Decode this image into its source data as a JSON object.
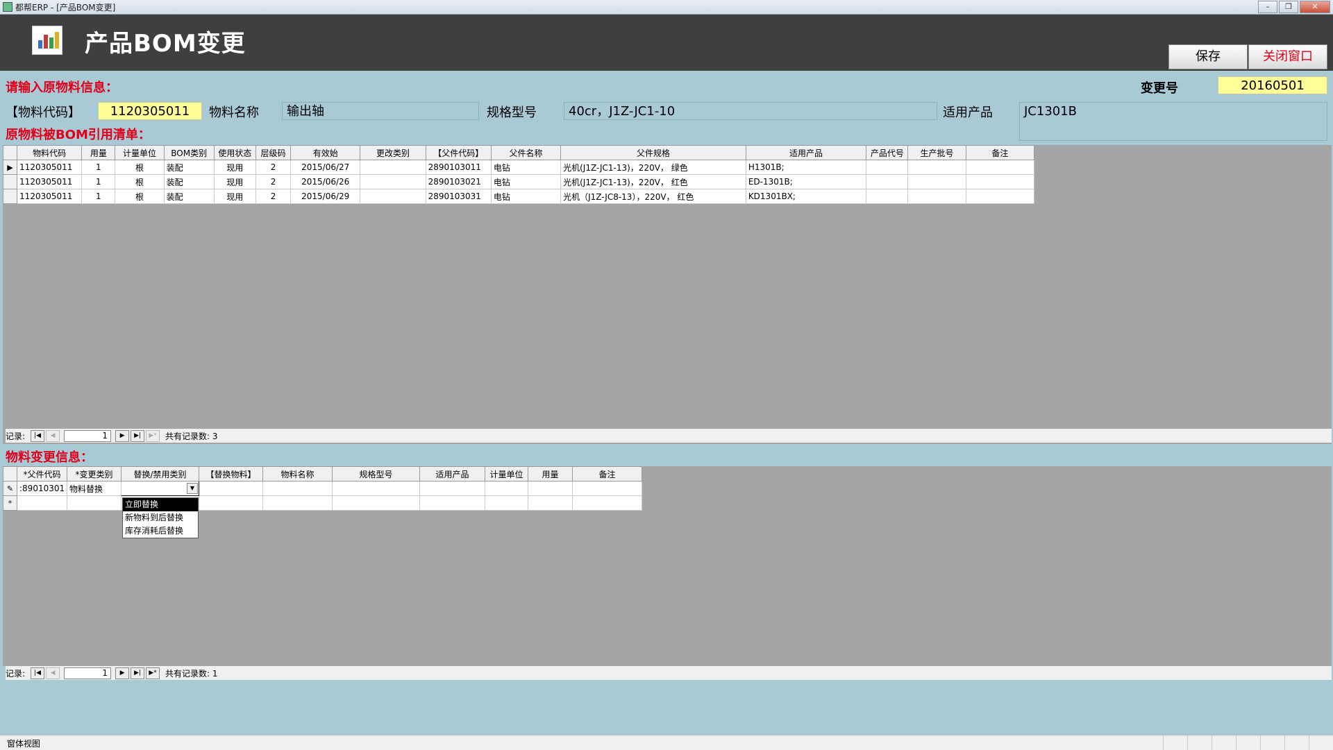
{
  "window": {
    "title": "都帮ERP - [产品BOM变更]"
  },
  "header": {
    "title": "产品BOM变更",
    "save_label": "保存",
    "close_label": "关闭窗口"
  },
  "input_section": {
    "heading": "请输入原物料信息：",
    "change_no_label": "变更号",
    "change_no": "20160501",
    "code_label": "【物料代码】",
    "code": "1120305011",
    "name_label": "物料名称",
    "name": "输出轴",
    "spec_label": "规格型号",
    "spec": "40cr，J1Z-JC1-10",
    "product_label": "适用产品",
    "product": "JC1301B"
  },
  "bom_section": {
    "heading": "原物料被BOM引用清单：",
    "columns": [
      "物料代码",
      "用量",
      "计量单位",
      "BOM类别",
      "使用状态",
      "层级码",
      "有效始",
      "更改类别",
      "【父件代码】",
      "父件名称",
      "父件规格",
      "适用产品",
      "产品代号",
      "生产批号",
      "备注"
    ],
    "rows": [
      [
        "1120305011",
        "1",
        "根",
        "装配",
        "现用",
        "2",
        "2015/06/27",
        "",
        "2890103011",
        "电钻",
        "光机(J1Z-JC1-13)，220V， 绿色",
        "H1301B;",
        "",
        "",
        ""
      ],
      [
        "1120305011",
        "1",
        "根",
        "装配",
        "现用",
        "2",
        "2015/06/26",
        "",
        "2890103021",
        "电钻",
        "光机(J1Z-JC1-13)，220V， 红色",
        "ED-1301B;",
        "",
        "",
        ""
      ],
      [
        "1120305011",
        "1",
        "根",
        "装配",
        "现用",
        "2",
        "2015/06/29",
        "",
        "2890103031",
        "电钻",
        "光机（J1Z-JC8-13），220V， 红色",
        "KD1301BX;",
        "",
        "",
        ""
      ]
    ],
    "nav": {
      "label": "记录:",
      "current": "1",
      "total_label": "共有记录数: 3"
    }
  },
  "change_section": {
    "heading": "物料变更信息：",
    "columns": [
      "*父件代码",
      "*变更类别",
      "替换/禁用类别",
      "【替换物料】",
      "物料名称",
      "规格型号",
      "适用产品",
      "计量单位",
      "用量",
      "备注"
    ],
    "row": [
      ":89010301",
      "物料替换",
      "",
      "",
      "",
      "",
      "",
      "",
      "",
      ""
    ],
    "dropdown_options": [
      "立即替换",
      "新物料到后替换",
      "库存消耗后替换"
    ],
    "nav": {
      "label": "记录:",
      "current": "1",
      "total_label": "共有记录数: 1"
    }
  },
  "status": {
    "text": "窗体视图"
  },
  "icons": {
    "row_pointer": "▶",
    "edit_pencil": "✎",
    "new_row": "*",
    "dropdown_arrow": "▼"
  }
}
